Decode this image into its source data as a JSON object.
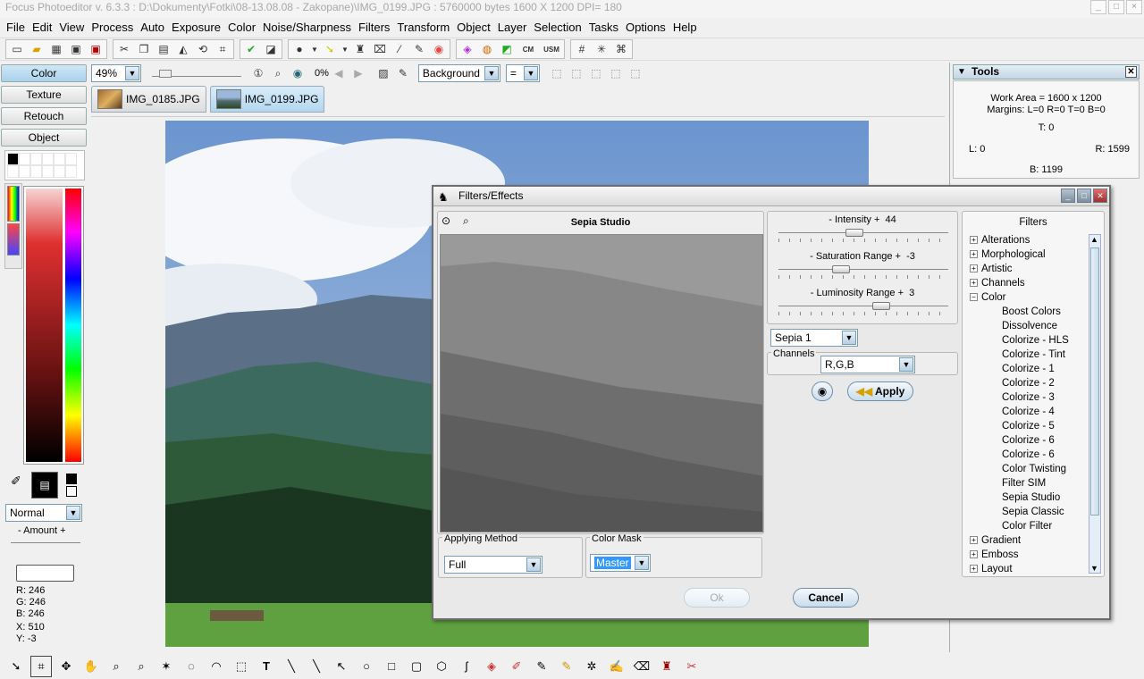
{
  "window": {
    "title": "Focus Photoeditor v. 6.3.3 :  D:\\Dokumenty\\Fotki\\08-13.08.08 - Zakopane)\\IMG_0199.JPG : 5760000 bytes    1600 X 1200 DPI= 180"
  },
  "menu": [
    "File",
    "Edit",
    "View",
    "Process",
    "Auto",
    "Exposure",
    "Color",
    "Noise/Sharpness",
    "Filters",
    "Transform",
    "Object",
    "Layer",
    "Selection",
    "Tasks",
    "Options",
    "Help"
  ],
  "sidetabs": [
    "Color",
    "Texture",
    "Retouch",
    "Object"
  ],
  "toolbar2": {
    "zoom": "49%",
    "percent": "0%",
    "layer": "Background",
    "blend": "="
  },
  "doctabs": [
    "IMG_0185.JPG",
    "IMG_0199.JPG"
  ],
  "left": {
    "blend_mode": "Normal",
    "amount_label": "- Amount +",
    "rgb": {
      "r": "R: 246",
      "g": "G: 246",
      "b": "B: 246"
    },
    "xy": {
      "x": "X: 510",
      "y": "Y: -3"
    }
  },
  "tools": {
    "title": "Tools",
    "work_area": "Work Area = 1600 x 1200",
    "margins": "Margins: L=0 R=0 T=0 B=0",
    "t": "T: 0",
    "l": "L: 0",
    "r": "R: 1599",
    "b": "B: 1199"
  },
  "dialog": {
    "title": "Filters/Effects",
    "preview_title": "Sepia Studio",
    "sliders": [
      {
        "label": "- Intensity +",
        "value": "44",
        "pos": 0.44
      },
      {
        "label": "- Saturation Range +",
        "value": "-3",
        "pos": 0.35
      },
      {
        "label": "- Luminosity Range +",
        "value": "3",
        "pos": 0.62
      }
    ],
    "preset": "Sepia 1",
    "channels_label": "Channels",
    "channels_value": "R,G,B",
    "apply": "Apply",
    "applying_method_label": "Applying Method",
    "applying_method_value": "Full",
    "color_mask_label": "Color Mask",
    "color_mask_value": "Master",
    "ok": "Ok",
    "cancel": "Cancel",
    "filters_header": "Filters",
    "tree": [
      {
        "label": "Alterations",
        "type": "group"
      },
      {
        "label": "Morphological",
        "type": "group"
      },
      {
        "label": "Artistic",
        "type": "group"
      },
      {
        "label": "Channels",
        "type": "group"
      },
      {
        "label": "Color",
        "type": "open"
      },
      {
        "label": "Boost Colors",
        "type": "child"
      },
      {
        "label": "Dissolvence",
        "type": "child"
      },
      {
        "label": "Colorize - HLS",
        "type": "child"
      },
      {
        "label": "Colorize - Tint",
        "type": "child"
      },
      {
        "label": "Colorize - 1",
        "type": "child"
      },
      {
        "label": "Colorize - 2",
        "type": "child"
      },
      {
        "label": "Colorize - 3",
        "type": "child"
      },
      {
        "label": "Colorize - 4",
        "type": "child"
      },
      {
        "label": "Colorize - 5",
        "type": "child"
      },
      {
        "label": "Colorize - 6",
        "type": "child"
      },
      {
        "label": "Colorize - 6",
        "type": "child"
      },
      {
        "label": "Color Twisting",
        "type": "child"
      },
      {
        "label": "Filter SIM",
        "type": "child"
      },
      {
        "label": "Sepia Studio",
        "type": "child"
      },
      {
        "label": "Sepia Classic",
        "type": "child"
      },
      {
        "label": "Color Filter",
        "type": "child"
      },
      {
        "label": "Gradient",
        "type": "group"
      },
      {
        "label": "Emboss",
        "type": "group"
      },
      {
        "label": "Layout",
        "type": "group"
      }
    ]
  },
  "icons": {
    "toolbar1": [
      "new-icon",
      "open-icon",
      "grid-icon",
      "save-as-icon",
      "save-icon",
      "cut-icon",
      "copy-icon",
      "paste-icon",
      "flip-icon",
      "rotate-icon",
      "crop-icon",
      "check-icon",
      "levels-icon",
      "circle-icon",
      "arrow-icon",
      "brush-icon",
      "picker-icon",
      "selection-icon",
      "wand-icon",
      "color-wheel-icon",
      "hue-icon",
      "curves-icon",
      "palette-icon",
      "cm-icon",
      "usm-icon",
      "grid2-icon",
      "target-icon",
      "network-icon"
    ]
  },
  "colors": {
    "accent": "#a9d2ec",
    "dialog_bg": "#e9e9e9"
  }
}
